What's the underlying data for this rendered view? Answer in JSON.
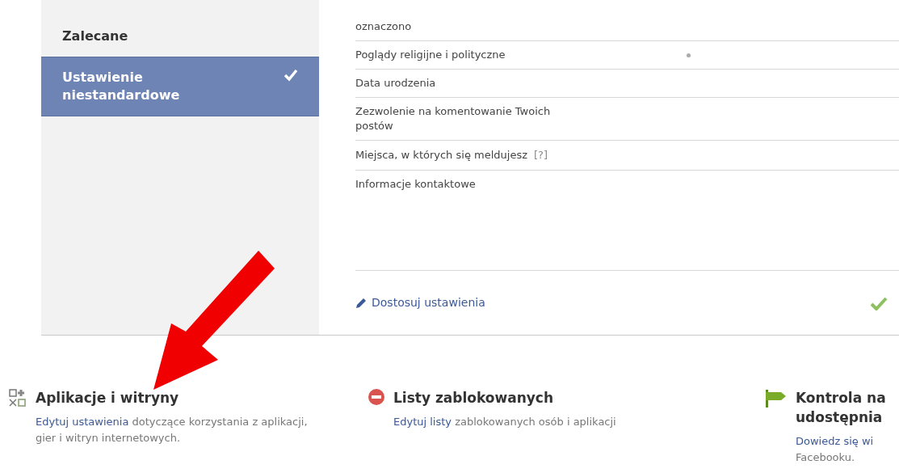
{
  "sidebar": {
    "items": [
      {
        "label": "Zalecane",
        "selected": false
      },
      {
        "label": "Ustawienie niestandardowe",
        "selected": true
      }
    ]
  },
  "settings": {
    "rows": [
      {
        "label": "oznaczono",
        "marker": false
      },
      {
        "label": "Poglądy religijne i polityczne",
        "marker": true
      },
      {
        "label": "Data urodzenia",
        "marker": false
      },
      {
        "label": "Zezwolenie na komentowanie Twoich postów",
        "marker": false
      },
      {
        "label": "Miejsca, w których się meldujesz",
        "help": "[?]",
        "marker": false
      },
      {
        "label": "Informacje kontaktowe",
        "marker": false
      }
    ],
    "customize_link": "Dostosuj ustawienia",
    "applied": true
  },
  "sections": [
    {
      "kind": "apps",
      "title_lines": [
        "Aplikacje i witryny"
      ],
      "description": [
        {
          "link": "Edytuj ustawienia",
          "text": " dotyczące korzystania z aplikacji, gier i witryn internetowych."
        }
      ]
    },
    {
      "kind": "blocked",
      "title_lines": [
        "Listy zablokowanych"
      ],
      "description": [
        {
          "link": "Edytuj listy",
          "text": " zablokowanych osób i aplikacji"
        }
      ]
    },
    {
      "kind": "signpost",
      "title_lines": [
        "Kontrola na",
        "udostępnia"
      ],
      "description": [
        {
          "link": "Dowiedz się wi"
        },
        {
          "text": "Facebooku."
        }
      ]
    }
  ]
}
